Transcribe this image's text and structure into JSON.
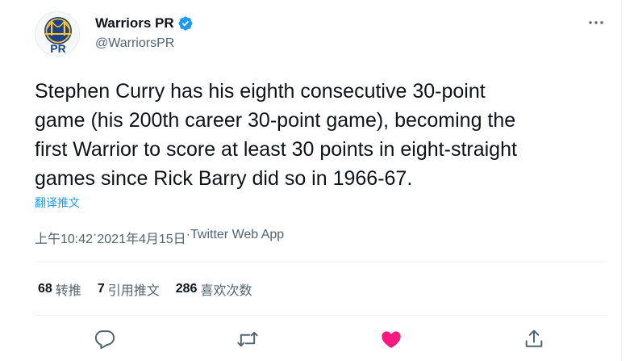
{
  "author": {
    "display_name": "Warriors PR",
    "handle": "@WarriorsPR",
    "avatar_text": "PR"
  },
  "tweet": {
    "text": "Stephen Curry has his eighth consecutive 30-point\ngame (his 200th career 30-point game), becoming the\nfirst Warrior to score at least 30 points in eight-straight\ngames since Rick Barry did so in 1966-67.",
    "translate_label": "翻译推文",
    "time": "上午10:42",
    "separator1": " · ",
    "date": "2021年4月15日",
    "separator2": " · ",
    "source": "Twitter Web App"
  },
  "stats": {
    "retweets_count": "68",
    "retweets_label": "转推",
    "quotes_count": "7",
    "quotes_label": "引用推文",
    "likes_count": "286",
    "likes_label": "喜欢次数"
  },
  "colors": {
    "accent": "#1d9bf0",
    "like": "#f91880",
    "secondary_text": "#536471",
    "primary_text": "#0f1419",
    "warriors_blue": "#1d428a",
    "warriors_gold": "#ffc72c"
  },
  "icons": {
    "verified": "verified-badge-icon",
    "more": "more-dots-icon",
    "reply": "reply-icon",
    "retweet": "retweet-icon",
    "like": "heart-filled-icon",
    "share": "share-icon"
  }
}
